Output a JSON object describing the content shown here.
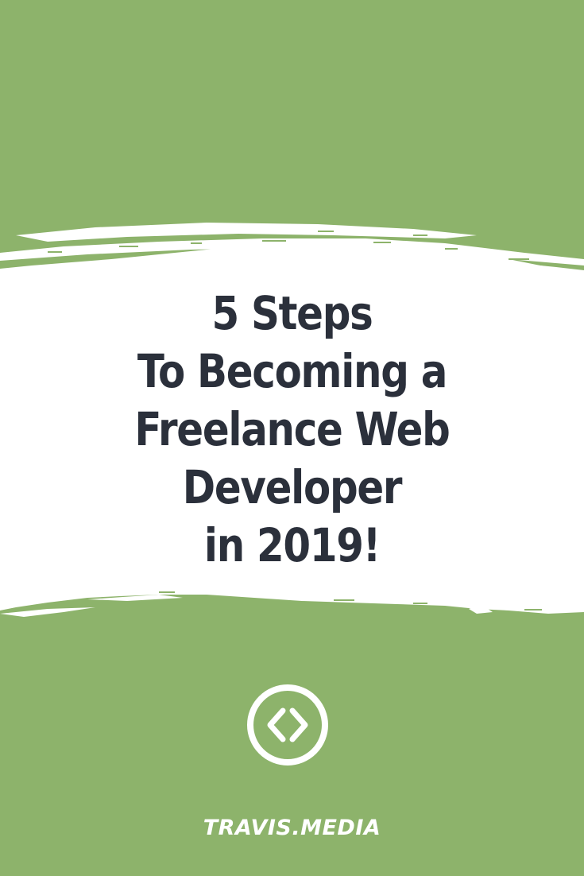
{
  "colors": {
    "background": "#8db36b",
    "band": "#ffffff",
    "title_text": "#2b303b",
    "brand_text": "#ffffff"
  },
  "title": {
    "lines": [
      "5 Steps",
      "To Becoming a",
      "Freelance Web",
      "Developer",
      "in 2019!"
    ]
  },
  "logo": {
    "icon": "code-brackets-icon"
  },
  "brand": {
    "name": "TRAVIS.MEDIA"
  }
}
